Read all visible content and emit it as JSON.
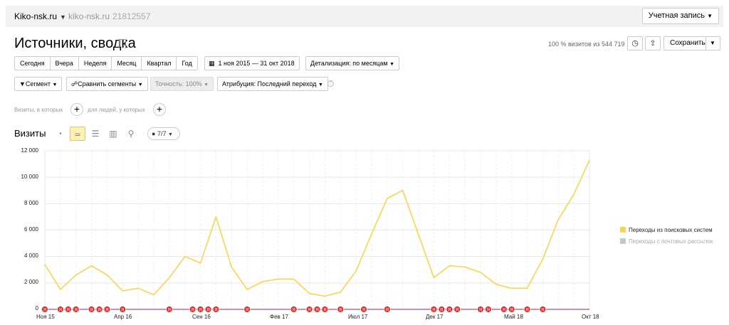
{
  "header": {
    "site_name": "Kiko-nsk.ru",
    "site_domain": "kiko-nsk.ru",
    "counter_id": "21812557",
    "account_label": "Учетная запись"
  },
  "report": {
    "title": "Источники, сводка",
    "visits_share": "100 % визитов из 544 719",
    "save_label": "Сохранить"
  },
  "periods": [
    "Сегодня",
    "Вчера",
    "Неделя",
    "Месяц",
    "Квартал",
    "Год"
  ],
  "date_range": "1 ноя 2015 — 31 окт 2018",
  "detail": "Детализация: по месяцам",
  "toolbar": {
    "segment": "Сегмент",
    "compare": "Сравнить сегменты",
    "accuracy": "Точность: 100%",
    "attribution": "Атрибуция: Последний переход"
  },
  "conditions": {
    "visits_label": "Визиты, в которых",
    "people_label": "для людей, у которых"
  },
  "chart_header": {
    "title": "Визиты",
    "annotations_label": "7/7"
  },
  "chart_data": {
    "type": "line",
    "ylim": [
      0,
      12000
    ],
    "y_ticks": [
      "12 000",
      "10 000",
      "8 000",
      "6 000",
      "4 000",
      "2 000",
      "0"
    ],
    "x_tick_labels": [
      "Ноя 15",
      "Апр 16",
      "Сен 16",
      "Фев 17",
      "Июл 17",
      "Дек 17",
      "Май 18",
      "Окт 18"
    ],
    "months_count": 36,
    "series": [
      {
        "name": "Переходы из поисковых систем",
        "color": "#ffd24d",
        "enabled": true,
        "values": [
          3400,
          1500,
          2600,
          3300,
          2600,
          1400,
          1600,
          1100,
          2400,
          4000,
          3500,
          7000,
          3200,
          1500,
          2100,
          2300,
          2300,
          1200,
          1000,
          1300,
          2900,
          5700,
          8400,
          9000,
          5700,
          2400,
          3300,
          3200,
          2800,
          1900,
          1600,
          1600,
          3800,
          6800,
          8700,
          11300
        ]
      },
      {
        "name": "Переходы с почтовых рассылок",
        "color": "#c8c8c8",
        "enabled": false,
        "values": []
      }
    ],
    "annotation_marker_text": "Я"
  }
}
